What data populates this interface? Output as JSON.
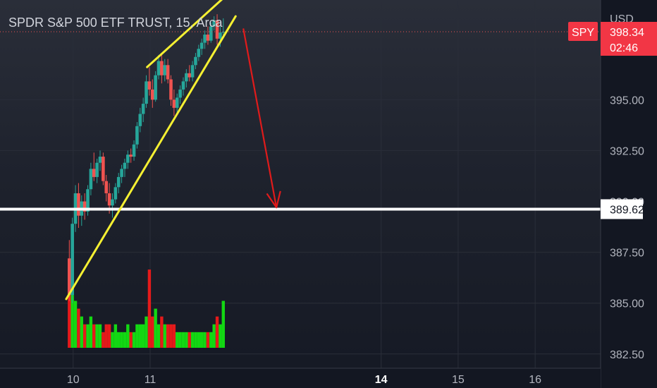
{
  "header": {
    "symbol_title": "SPDR S&P 500 ETF TRUST",
    "interval": "15",
    "exchange": "Arca",
    "currency": "USD"
  },
  "price_tag": {
    "symbol": "SPY",
    "price": "398.34",
    "countdown": "02:46",
    "color": "#f23645"
  },
  "level_tag": {
    "price": "389.62"
  },
  "chart_data": {
    "type": "candlestick",
    "y_axis": {
      "range": [
        381.8,
        399.9
      ],
      "ticks": [
        "395.00",
        "392.50",
        "387.50",
        "385.00",
        "382.50"
      ]
    },
    "x_axis": {
      "range": [
        9.05,
        16.85
      ],
      "ticks": [
        "10",
        "11",
        "14",
        "15",
        "16"
      ],
      "highlighted_tick": "14"
    },
    "current_price": 398.34,
    "horizontal_level": 389.62,
    "colors": {
      "up": "#26a69a",
      "down": "#ef5350",
      "vol_up": "#13d813",
      "vol_down": "#e51a1a",
      "wedge": "#f5f032",
      "arrow": "#e01b1b",
      "level": "#ffffff"
    },
    "candles": [
      [
        9.95,
        387.2,
        388.1,
        385.1,
        385.4,
        9
      ],
      [
        9.99,
        385.4,
        389.2,
        385.0,
        388.9,
        11
      ],
      [
        10.03,
        388.9,
        390.8,
        388.5,
        390.4,
        6
      ],
      [
        10.07,
        390.4,
        390.9,
        388.7,
        389.3,
        5
      ],
      [
        10.11,
        389.3,
        390.3,
        388.8,
        390.0,
        4
      ],
      [
        10.15,
        390.0,
        390.4,
        389.1,
        389.5,
        3
      ],
      [
        10.19,
        389.5,
        390.8,
        389.3,
        390.6,
        3
      ],
      [
        10.23,
        390.6,
        391.9,
        390.3,
        391.6,
        4
      ],
      [
        10.27,
        391.6,
        392.4,
        391.0,
        391.2,
        3
      ],
      [
        10.31,
        391.2,
        392.1,
        390.9,
        391.9,
        3
      ],
      [
        10.35,
        391.9,
        392.5,
        391.5,
        392.2,
        3
      ],
      [
        10.39,
        392.2,
        392.4,
        390.8,
        391.0,
        2
      ],
      [
        10.43,
        391.0,
        391.3,
        390.0,
        390.4,
        3
      ],
      [
        10.47,
        390.4,
        390.9,
        389.4,
        389.8,
        3
      ],
      [
        10.51,
        389.8,
        390.4,
        389.2,
        390.1,
        2
      ],
      [
        10.55,
        390.1,
        390.9,
        389.9,
        390.7,
        3
      ],
      [
        10.59,
        390.7,
        391.4,
        390.4,
        391.2,
        2
      ],
      [
        10.63,
        391.2,
        391.8,
        390.9,
        391.6,
        2
      ],
      [
        10.67,
        391.6,
        392.1,
        391.2,
        391.9,
        2
      ],
      [
        10.71,
        391.9,
        392.5,
        391.6,
        392.3,
        3
      ],
      [
        10.75,
        392.3,
        392.6,
        391.9,
        392.2,
        2
      ],
      [
        10.79,
        392.2,
        393.0,
        392.0,
        392.8,
        2
      ],
      [
        10.83,
        392.8,
        393.9,
        392.6,
        393.7,
        3
      ],
      [
        10.87,
        393.7,
        394.6,
        393.4,
        394.3,
        3
      ],
      [
        10.91,
        394.3,
        395.1,
        393.9,
        394.8,
        3
      ],
      [
        10.95,
        394.8,
        396.2,
        394.6,
        395.9,
        4
      ],
      [
        10.99,
        395.9,
        396.6,
        395.2,
        395.5,
        10
      ],
      [
        11.03,
        395.5,
        396.0,
        394.6,
        395.0,
        4
      ],
      [
        11.07,
        395.0,
        396.4,
        394.9,
        396.2,
        5
      ],
      [
        11.11,
        396.2,
        397.2,
        396.0,
        396.9,
        3
      ],
      [
        11.15,
        396.9,
        397.3,
        395.8,
        396.2,
        4
      ],
      [
        11.19,
        396.2,
        397.0,
        395.9,
        396.7,
        3
      ],
      [
        11.23,
        396.7,
        397.0,
        395.8,
        396.0,
        3
      ],
      [
        11.27,
        396.0,
        396.2,
        394.7,
        395.0,
        3
      ],
      [
        11.31,
        395.0,
        395.5,
        394.2,
        394.6,
        3
      ],
      [
        11.35,
        394.6,
        395.3,
        394.3,
        395.1,
        2
      ],
      [
        11.39,
        395.1,
        395.7,
        394.8,
        395.5,
        2
      ],
      [
        11.43,
        395.5,
        396.1,
        395.2,
        395.9,
        2
      ],
      [
        11.47,
        395.9,
        396.5,
        395.6,
        396.3,
        2
      ],
      [
        11.51,
        396.3,
        396.7,
        395.9,
        396.1,
        2
      ],
      [
        11.55,
        396.1,
        396.9,
        395.9,
        396.7,
        2
      ],
      [
        11.59,
        396.7,
        397.3,
        396.5,
        397.1,
        2
      ],
      [
        11.63,
        397.1,
        397.7,
        396.9,
        397.5,
        2
      ],
      [
        11.67,
        397.5,
        398.0,
        397.2,
        397.8,
        2
      ],
      [
        11.71,
        397.8,
        398.4,
        397.5,
        398.2,
        2
      ],
      [
        11.75,
        398.2,
        398.6,
        397.7,
        397.9,
        2
      ],
      [
        11.79,
        397.9,
        398.8,
        397.8,
        398.6,
        2
      ],
      [
        11.83,
        398.6,
        399.1,
        398.4,
        398.9,
        3
      ],
      [
        11.87,
        398.9,
        399.2,
        397.7,
        398.0,
        4
      ],
      [
        11.91,
        398.0,
        398.6,
        397.6,
        398.3,
        3
      ],
      [
        11.95,
        398.3,
        399.0,
        398.1,
        398.34,
        6
      ]
    ],
    "wedge_lines": [
      {
        "from": [
          9.91,
          385.2
        ],
        "to": [
          12.11,
          399.1
        ]
      },
      {
        "from": [
          10.96,
          396.6
        ],
        "to": [
          12.04,
          400.3
        ]
      }
    ],
    "projection_arrow": {
      "from": [
        12.21,
        398.5
      ],
      "to": [
        12.64,
        389.7
      ]
    }
  }
}
